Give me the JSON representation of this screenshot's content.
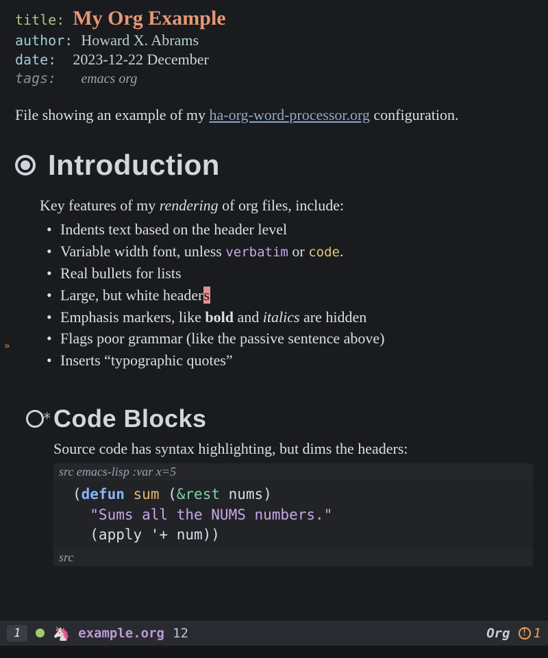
{
  "meta": {
    "title_key": "title",
    "title_val": "My Org Example",
    "author_key": "author",
    "author_val": "Howard X. Abrams",
    "date_key": "date",
    "date_val": "2023-12-22 December",
    "tags_key": "tags:",
    "tags_val": "emacs org"
  },
  "intro_para_pre": "File showing an example of my ",
  "intro_link_text": "ha-org-word-processor.org",
  "intro_para_post": " configuration.",
  "h1": "Introduction",
  "features_lead_pre": "Key features of my ",
  "features_lead_em": "rendering",
  "features_lead_post": " of org files, include:",
  "bullets": {
    "b0": "Indents text based on the header level",
    "b1_pre": "Variable width font, unless ",
    "b1_verbatim": "verbatim",
    "b1_mid": " or ",
    "b1_code": "code",
    "b1_post": ".",
    "b2": "Real bullets for lists",
    "b3_pre": "Large, but white header",
    "b3_cursor": "s",
    "b4_pre": "Emphasis markers, like ",
    "b4_bold": "bold",
    "b4_mid": " and ",
    "b4_italic": "italics",
    "b4_post": " are hidden",
    "b5": "Flags poor grammar (like the passive sentence above)",
    "b6": "Inserts “typographic quotes”"
  },
  "h2_star": "*",
  "h2": "Code Blocks",
  "src_lead": "Source code has syntax highlighting, but dims the headers:",
  "src_begin": "src emacs-lisp :var x=5",
  "src_end": "src",
  "code": {
    "l1_open": "(",
    "l1_defun": "defun",
    "l1_sp": " ",
    "l1_name": "sum",
    "l1_args_open": " (",
    "l1_amp": "&rest",
    "l1_args_rest": " nums)",
    "l2_doc": "  \"Sums all the NUMS numbers.\"",
    "l3": "  (apply '+ num))"
  },
  "modeline": {
    "winnum": "1",
    "filename": "example.org",
    "line": "12",
    "major_mode": "Org",
    "warn_count": "1"
  },
  "fringe_arrow": "»"
}
